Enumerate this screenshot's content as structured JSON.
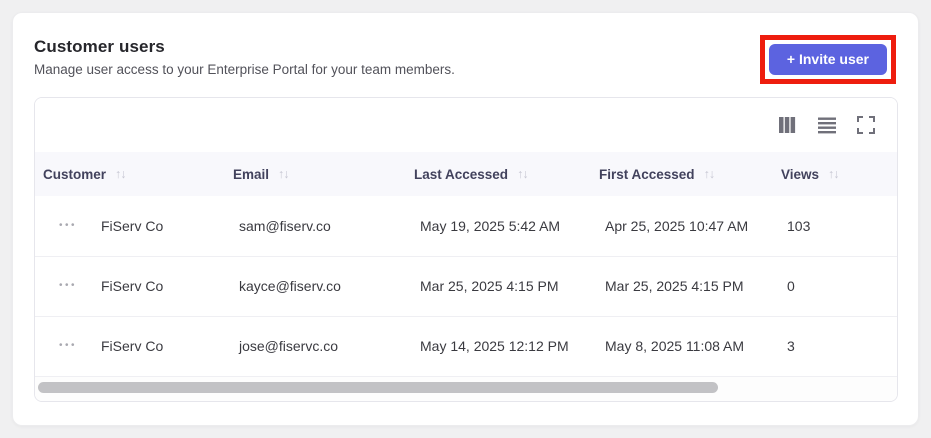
{
  "page": {
    "title": "Customer users",
    "subtitle": "Manage user access to your Enterprise Portal for your team members."
  },
  "actions": {
    "invite_button_label": "+ Invite user"
  },
  "icons": {
    "sort": "↑↓",
    "row_menu": "•••",
    "toolbar": [
      "columns-icon",
      "row-density-icon",
      "fullscreen-icon"
    ]
  },
  "colors": {
    "accent": "#5c63e0",
    "annotation_highlight": "#ee1d0e",
    "header_bg": "#f8f8fc"
  },
  "table": {
    "columns": [
      {
        "label": "Customer",
        "sortable": true
      },
      {
        "label": "Email",
        "sortable": true
      },
      {
        "label": "Last Accessed",
        "sortable": true
      },
      {
        "label": "First Accessed",
        "sortable": true
      },
      {
        "label": "Views",
        "sortable": true
      }
    ],
    "rows": [
      {
        "customer": "FiServ Co",
        "email": "sam@fiserv.co",
        "last_accessed": "May 19, 2025 5:42 AM",
        "first_accessed": "Apr 25, 2025 10:47 AM",
        "views": "103"
      },
      {
        "customer": "FiServ Co",
        "email": "kayce@fiserv.co",
        "last_accessed": "Mar 25, 2025 4:15 PM",
        "first_accessed": "Mar 25, 2025 4:15 PM",
        "views": "0"
      },
      {
        "customer": "FiServ Co",
        "email": "jose@fiservc.co",
        "last_accessed": "May 14, 2025 12:12 PM",
        "first_accessed": "May 8, 2025 11:08 AM",
        "views": "3"
      }
    ]
  }
}
